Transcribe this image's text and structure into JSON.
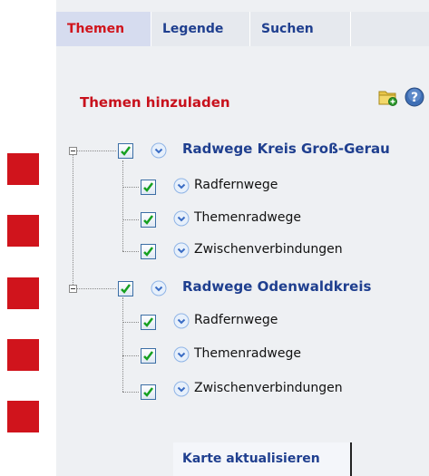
{
  "tabs": [
    {
      "label": "Themen",
      "active": true
    },
    {
      "label": "Legende",
      "active": false
    },
    {
      "label": "Suchen",
      "active": false
    }
  ],
  "themen_title": "Themen hinzuladen",
  "groups": [
    {
      "label": "Radwege Kreis Groß-Gerau",
      "checked": true,
      "items": [
        {
          "label": "Radfernwege",
          "checked": true
        },
        {
          "label": "Themenradwege",
          "checked": true
        },
        {
          "label": "Zwischenverbindungen",
          "checked": true
        }
      ]
    },
    {
      "label": "Radwege Odenwaldkreis",
      "checked": true,
      "items": [
        {
          "label": "Radfernwege",
          "checked": true
        },
        {
          "label": "Themenradwege",
          "checked": true
        },
        {
          "label": "Zwischenverbindungen",
          "checked": true
        }
      ]
    }
  ],
  "update_button": "Karte aktualisieren",
  "icons": {
    "add_folder": "folder-add-icon",
    "help": "help-icon",
    "info": "chevron-info-icon"
  },
  "colors": {
    "accent_red": "#d0141c",
    "link_blue": "#1f3f8f",
    "check_green": "#16a020"
  }
}
